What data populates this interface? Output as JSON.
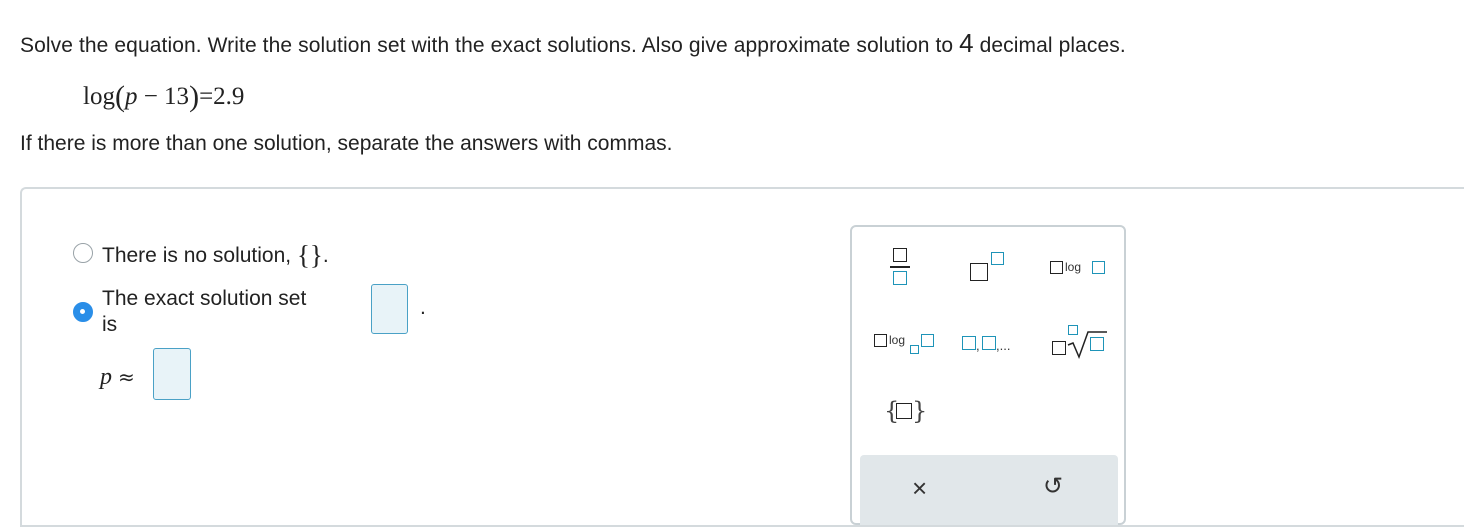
{
  "question": {
    "instruction_prefix": "Solve the equation. Write the solution set with the exact solutions. Also give approximate solution to ",
    "instruction_number": "4",
    "instruction_suffix": " decimal places.",
    "equation": {
      "func": "log",
      "variable": "p",
      "inner_rest": " − 13",
      "rhs": "=2.9"
    },
    "note": "If there is more than one solution, separate the answers with commas."
  },
  "options": {
    "no_solution": {
      "label": "There is no solution, ",
      "braces": "{}",
      "after": ".",
      "selected": false
    },
    "exact_set": {
      "label_line1": "The exact solution set",
      "label_line2": "is",
      "period": ".",
      "selected": true
    }
  },
  "approx": {
    "variable": "p",
    "symbol": "≈"
  },
  "palette": {
    "buttons": [
      {
        "name": "fraction",
        "icon": "fraction-icon"
      },
      {
        "name": "exponent",
        "icon": "exponent-icon"
      },
      {
        "name": "log",
        "icon": "log-icon",
        "text": "log"
      },
      {
        "name": "log-base",
        "icon": "log-base-icon",
        "text": "log"
      },
      {
        "name": "list",
        "icon": "list-icon",
        "text": ",..."
      },
      {
        "name": "nth-root",
        "icon": "nth-root-icon"
      },
      {
        "name": "set-braces",
        "icon": "set-braces-icon"
      }
    ],
    "clear_symbol": "×",
    "undo_symbol": "↺"
  },
  "colors": {
    "accent": "#2a8ee8",
    "input_border": "#4aa1c6",
    "input_fill": "#e8f3f8",
    "palette_teal": "#1e94b8",
    "footer_bg": "#e1e7ea"
  }
}
